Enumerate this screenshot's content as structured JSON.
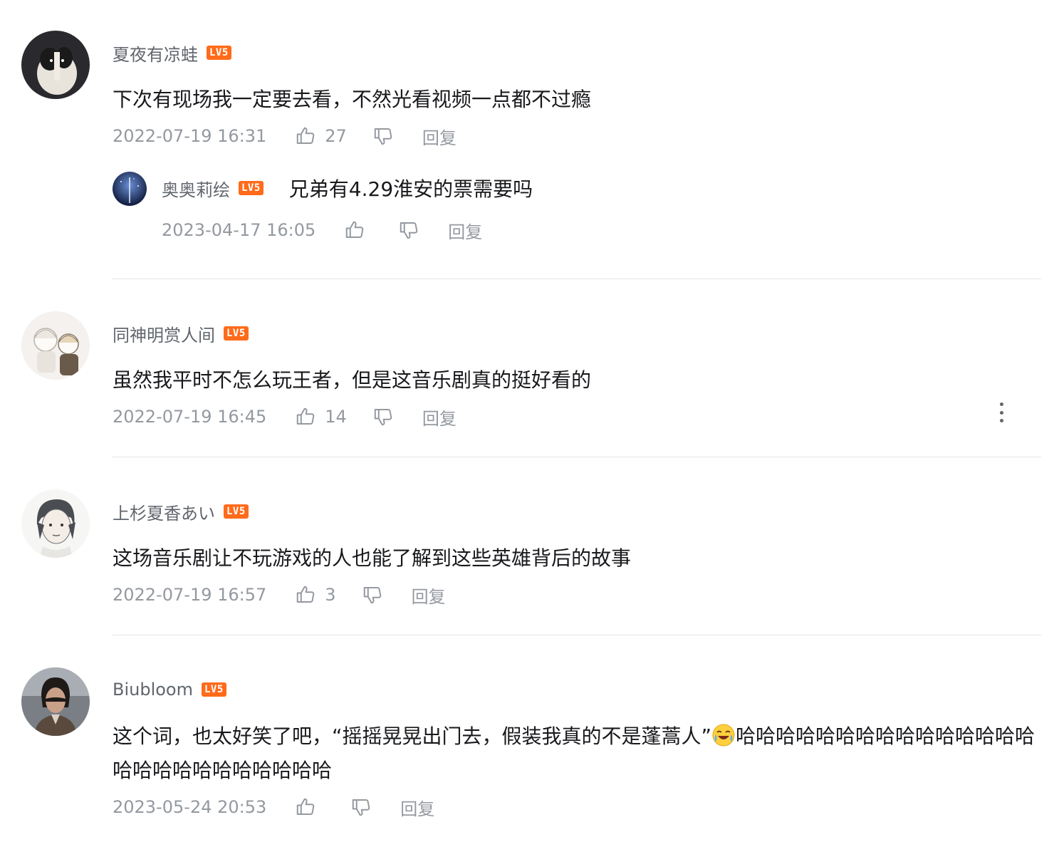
{
  "level_badge": "LV5",
  "colors": {
    "accent": "#ff6b1a",
    "muted": "#9499a0",
    "name": "#61666d",
    "text": "#18191c",
    "divider": "#e3e5e7"
  },
  "reply_label": "回复",
  "comments": [
    {
      "username": "夏夜有凉蛙",
      "content": "下次有现场我一定要去看，不然光看视频一点都不过瘾",
      "time": "2022-07-19 16:31",
      "likes": "27",
      "replies": [
        {
          "username": "奥奥莉绘",
          "content": "兄弟有4.29淮安的票需要吗",
          "time": "2023-04-17 16:05",
          "likes": ""
        }
      ]
    },
    {
      "username": "同神明赏人间",
      "content": "虽然我平时不怎么玩王者，但是这音乐剧真的挺好看的",
      "time": "2022-07-19 16:45",
      "likes": "14"
    },
    {
      "username": "上杉夏香あい",
      "content": "这场音乐剧让不玩游戏的人也能了解到这些英雄背后的故事",
      "time": "2022-07-19 16:57",
      "likes": "3"
    },
    {
      "username": "Biubloom",
      "content_part1": "这个词，也太好笑了吧，“摇摇晃晃出门去，假装我真的不是蓬蒿人”",
      "content_part2": "哈哈哈哈哈哈哈哈哈哈哈哈哈哈哈哈哈哈哈哈哈哈哈哈哈哈",
      "emoji": "laughing-crying-emoji",
      "time": "2023-05-24 20:53",
      "likes": ""
    }
  ]
}
